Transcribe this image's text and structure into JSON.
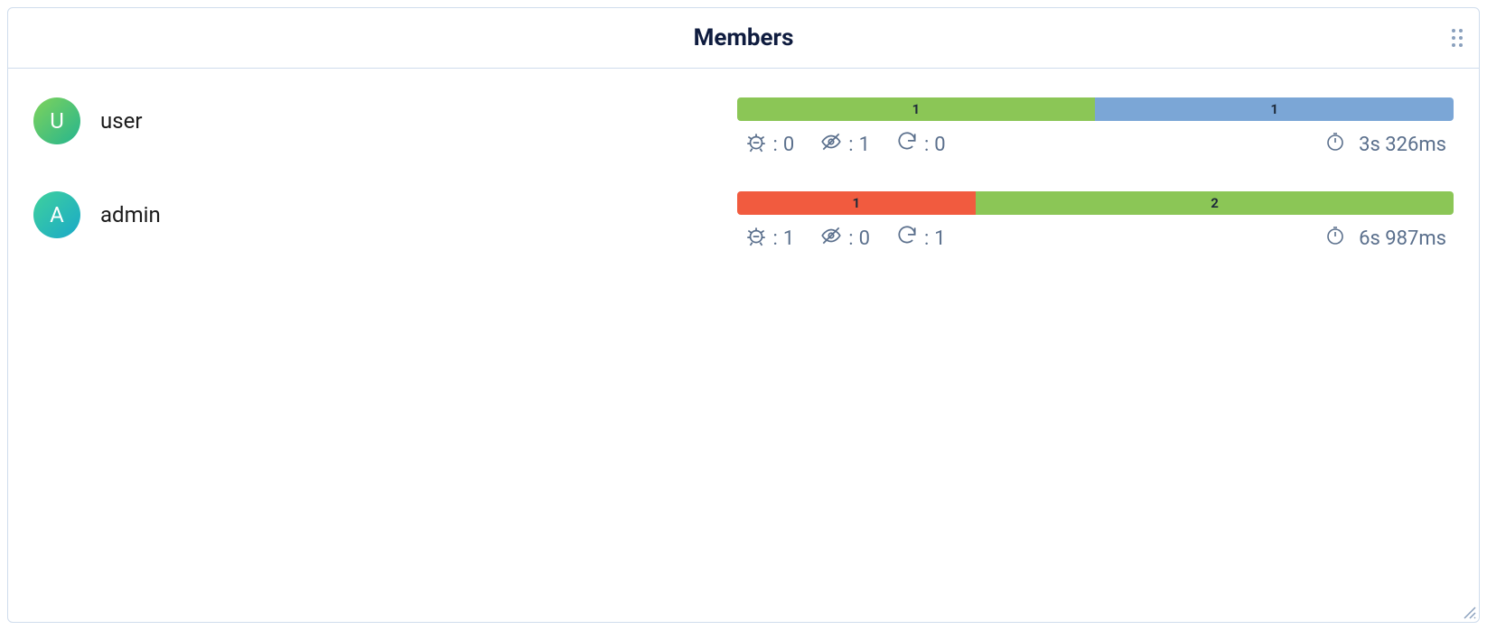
{
  "panel": {
    "title": "Members"
  },
  "members": [
    {
      "avatar_letter": "U",
      "avatar_gradient": [
        "#7fd35a",
        "#25b58f"
      ],
      "name": "user",
      "segments": [
        {
          "label": "1",
          "color": "green",
          "weight": 1
        },
        {
          "label": "1",
          "color": "blue",
          "weight": 1
        }
      ],
      "bug_count": "0",
      "skip_count": "1",
      "retry_count": "0",
      "duration": "3s 326ms"
    },
    {
      "avatar_letter": "A",
      "avatar_gradient": [
        "#3fd19c",
        "#1aa9c9"
      ],
      "name": "admin",
      "segments": [
        {
          "label": "1",
          "color": "red",
          "weight": 1
        },
        {
          "label": "2",
          "color": "green",
          "weight": 2
        }
      ],
      "bug_count": "1",
      "skip_count": "0",
      "retry_count": "1",
      "duration": "6s 987ms"
    }
  ]
}
